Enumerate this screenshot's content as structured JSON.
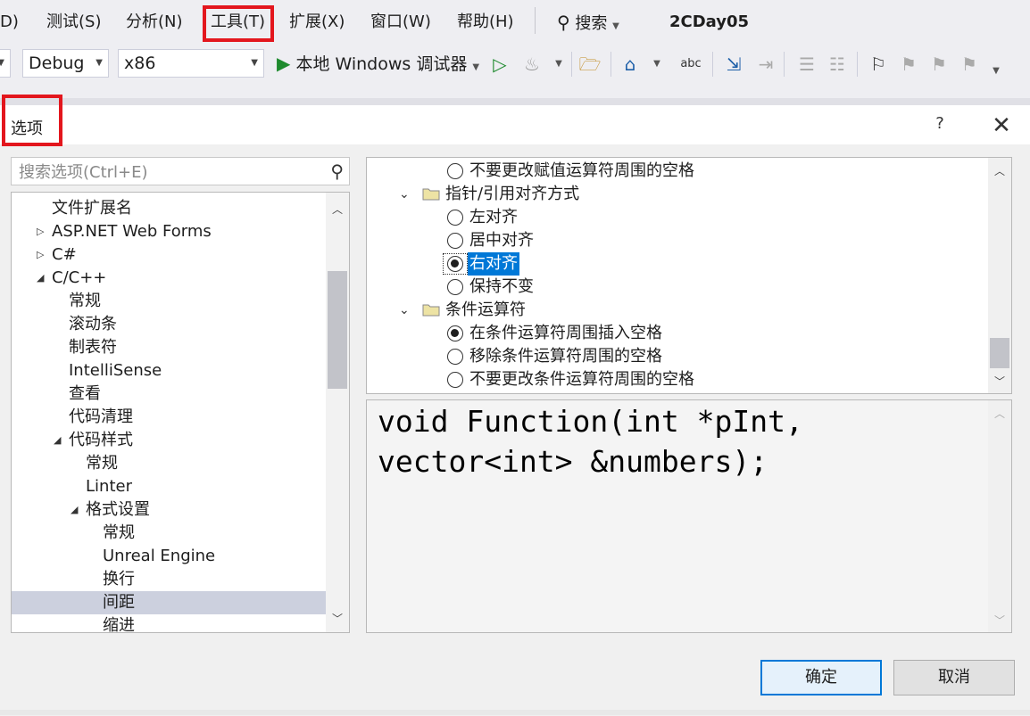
{
  "menubar": {
    "items": [
      {
        "label": "D)"
      },
      {
        "label": "测试(S)"
      },
      {
        "label": "分析(N)"
      },
      {
        "label": "工具(T)"
      },
      {
        "label": "扩展(X)"
      },
      {
        "label": "窗口(W)"
      },
      {
        "label": "帮助(H)"
      }
    ],
    "search_label": "搜索",
    "solution_name": "2CDay05"
  },
  "toolbar": {
    "config_value": "Debug",
    "platform_value": "x86",
    "run_label": "本地 Windows 调试器"
  },
  "dialog": {
    "title": "选项",
    "help": "?",
    "close": "✕",
    "search_placeholder": "搜索选项(Ctrl+E)",
    "tree": [
      {
        "label": "文件扩展名"
      },
      {
        "label": "ASP.NET Web Forms"
      },
      {
        "label": "C#"
      },
      {
        "label": "C/C++"
      },
      {
        "label": "常规"
      },
      {
        "label": "滚动条"
      },
      {
        "label": "制表符"
      },
      {
        "label": "IntelliSense"
      },
      {
        "label": "查看"
      },
      {
        "label": "代码清理"
      },
      {
        "label": "代码样式"
      },
      {
        "label": "常规"
      },
      {
        "label": "Linter"
      },
      {
        "label": "格式设置"
      },
      {
        "label": "常规"
      },
      {
        "label": "Unreal Engine"
      },
      {
        "label": "换行"
      },
      {
        "label": "间距"
      },
      {
        "label": "缩进"
      }
    ],
    "options": [
      {
        "label": "不要更改赋值运算符周围的空格"
      },
      {
        "label": "指针/引用对齐方式"
      },
      {
        "label": "左对齐"
      },
      {
        "label": "居中对齐"
      },
      {
        "label": "右对齐"
      },
      {
        "label": "保持不变"
      },
      {
        "label": "条件运算符"
      },
      {
        "label": "在条件运算符周围插入空格"
      },
      {
        "label": "移除条件运算符周围的空格"
      },
      {
        "label": "不要更改条件运算符周围的空格"
      }
    ],
    "preview_lines": [
      "void Function(int *pInt,",
      "vector<int> &numbers);"
    ],
    "ok_label": "确定",
    "cancel_label": "取消"
  },
  "colors": {
    "highlight_box": "#e3161d",
    "selection": "#0078d7",
    "run_green": "#1e8a2e"
  }
}
